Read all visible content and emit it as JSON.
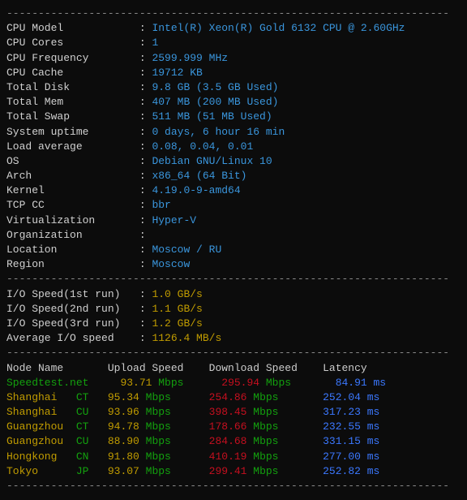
{
  "hr": "----------------------------------------------------------------------",
  "sys": [
    {
      "label": "CPU Model",
      "value": "Intel(R) Xeon(R) Gold 6132 CPU @ 2.60GHz"
    },
    {
      "label": "CPU Cores",
      "value": "1"
    },
    {
      "label": "CPU Frequency",
      "value": "2599.999 MHz"
    },
    {
      "label": "CPU Cache",
      "value": "19712 KB"
    },
    {
      "label": "Total Disk",
      "value": "9.8 GB (3.5 GB Used)"
    },
    {
      "label": "Total Mem",
      "value": "407 MB (200 MB Used)"
    },
    {
      "label": "Total Swap",
      "value": "511 MB (51 MB Used)"
    },
    {
      "label": "System uptime",
      "value": "0 days, 6 hour 16 min"
    },
    {
      "label": "Load average",
      "value": "0.08, 0.04, 0.01"
    },
    {
      "label": "OS",
      "value": "Debian GNU/Linux 10"
    },
    {
      "label": "Arch",
      "value": "x86_64 (64 Bit)"
    },
    {
      "label": "Kernel",
      "value": "4.19.0-9-amd64"
    },
    {
      "label": "TCP CC",
      "value": "bbr"
    },
    {
      "label": "Virtualization",
      "value": "Hyper-V"
    },
    {
      "label": "Organization",
      "value": ""
    },
    {
      "label": "Location",
      "value": "Moscow / RU"
    },
    {
      "label": "Region",
      "value": "Moscow"
    }
  ],
  "io": [
    {
      "label": "I/O Speed(1st run)",
      "value": "1.0 GB/s"
    },
    {
      "label": "I/O Speed(2nd run)",
      "value": "1.1 GB/s"
    },
    {
      "label": "I/O Speed(3rd run)",
      "value": "1.2 GB/s"
    },
    {
      "label": "Average I/O speed",
      "value": "1126.4 MB/s"
    }
  ],
  "speed_header": {
    "c1": "Node Name",
    "c2": "Upload Speed",
    "c3": "Download Speed",
    "c4": "Latency"
  },
  "speed": [
    {
      "node": "Speedtest.net",
      "tag": "",
      "upv": "93.71",
      "upu": "Mbps",
      "dnv": "295.94",
      "dnu": "Mbps",
      "lat": "84.91 ms",
      "nodeColor": "green"
    },
    {
      "node": "Shanghai",
      "tag": "CT",
      "upv": "95.34",
      "upu": "Mbps",
      "dnv": "254.86",
      "dnu": "Mbps",
      "lat": "252.04 ms",
      "nodeColor": "yellow"
    },
    {
      "node": "Shanghai",
      "tag": "CU",
      "upv": "93.96",
      "upu": "Mbps",
      "dnv": "398.45",
      "dnu": "Mbps",
      "lat": "317.23 ms",
      "nodeColor": "yellow"
    },
    {
      "node": "Guangzhou",
      "tag": "CT",
      "upv": "94.78",
      "upu": "Mbps",
      "dnv": "178.66",
      "dnu": "Mbps",
      "lat": "232.55 ms",
      "nodeColor": "yellow"
    },
    {
      "node": "Guangzhou",
      "tag": "CU",
      "upv": "88.90",
      "upu": "Mbps",
      "dnv": "284.68",
      "dnu": "Mbps",
      "lat": "331.15 ms",
      "nodeColor": "yellow"
    },
    {
      "node": "Hongkong",
      "tag": "CN",
      "upv": "91.80",
      "upu": "Mbps",
      "dnv": "410.19",
      "dnu": "Mbps",
      "lat": "277.00 ms",
      "nodeColor": "yellow"
    },
    {
      "node": "Tokyo",
      "tag": "JP",
      "upv": "93.07",
      "upu": "Mbps",
      "dnv": "299.41",
      "dnu": "Mbps",
      "lat": "252.82 ms",
      "nodeColor": "yellow"
    }
  ]
}
